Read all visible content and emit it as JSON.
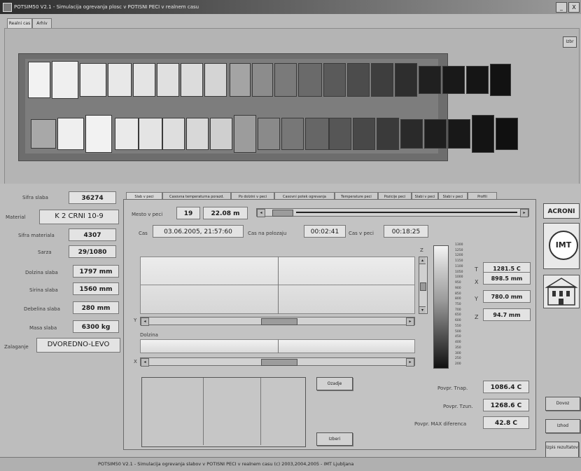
{
  "window": {
    "title": "POTSIM50 V2.1 - Simulacija ogrevanja plosc v POTISNI PECI v realnem casu",
    "minimize": "_",
    "close": "X"
  },
  "top_tabs": [
    "Realni cas",
    "Arhiv"
  ],
  "upper_button": "Izbr",
  "slab_info": {
    "fields": [
      {
        "label": "Sifra slaba",
        "value": "36274"
      },
      {
        "label": "Material",
        "value": "K 2 CRNI 10-9"
      },
      {
        "label": "Sifra materiala",
        "value": "4307"
      },
      {
        "label": "Sarza",
        "value": "29/1080"
      },
      {
        "label": "Dolzina slaba",
        "value": "1797 mm"
      },
      {
        "label": "Sirina slaba",
        "value": "1560 mm"
      },
      {
        "label": "Debelina slaba",
        "value": "280 mm"
      },
      {
        "label": "Masa slaba",
        "value": "6300 kg"
      },
      {
        "label": "Zalaganje",
        "value": "DVOREDNO-LEVO"
      }
    ]
  },
  "panel_tabs": [
    "Slab v peci",
    "Casovna temperaturna porazd.",
    "Po dolzini v peci",
    "Casovni potek ogrevanja",
    "Temperature peci",
    "Pozicije peci",
    "Slabi v peci",
    "Slabi v peci",
    "Profili"
  ],
  "position": {
    "mesto_label": "Mesto v peci",
    "mesto_value": "19",
    "distance": "22.08 m"
  },
  "times": {
    "cas_label": "Cas",
    "cas_value": "03.06.2005, 21:57:60",
    "na_polozaju_label": "Cas na polozaju",
    "na_polozaju_value": "00:02:41",
    "v_peci_label": "Cas v peci",
    "v_peci_value": "00:18:25"
  },
  "section_labels": {
    "z_axis": "Z",
    "y_axis": "Y",
    "x_axis": "X",
    "dolzina": "Dolzina"
  },
  "colorbar_ticks": [
    "1300",
    "1250",
    "1200",
    "1150",
    "1100",
    "1050",
    "1000",
    "950",
    "900",
    "850",
    "800",
    "750",
    "700",
    "650",
    "600",
    "550",
    "500",
    "450",
    "400",
    "350",
    "300",
    "250",
    "200"
  ],
  "point": {
    "t_label": "T",
    "t_value": "1281.5 C",
    "x_label": "X",
    "x_value": "898.5 mm",
    "y_label": "Y",
    "y_value": "780.0 mm",
    "z_label": "Z",
    "z_value": "94.7 mm"
  },
  "averages": [
    {
      "label": "Povpr. Tnap.",
      "value": "1086.4 C"
    },
    {
      "label": "Povpr. Tzun.",
      "value": "1268.6 C"
    },
    {
      "label": "Povpr. MAX diferenca",
      "value": "42.8 C"
    }
  ],
  "buttons": {
    "ozadje": "Ozadje",
    "izberi": "Izberi"
  },
  "right_buttons": [
    "Dovoz",
    "Izhod",
    "Izpis rezultatov"
  ],
  "logos": [
    "ACRONI",
    "IMT",
    "FS"
  ],
  "status": "POTSIM50 V2.1 - Simulacija ogrevanja slabov v POTISNI PECI v realnem casu   (c) 2003,2004,2005 - IMT Ljubljana",
  "colors": {
    "accent": "#6d6d6d",
    "background": "#b9b9b9"
  }
}
